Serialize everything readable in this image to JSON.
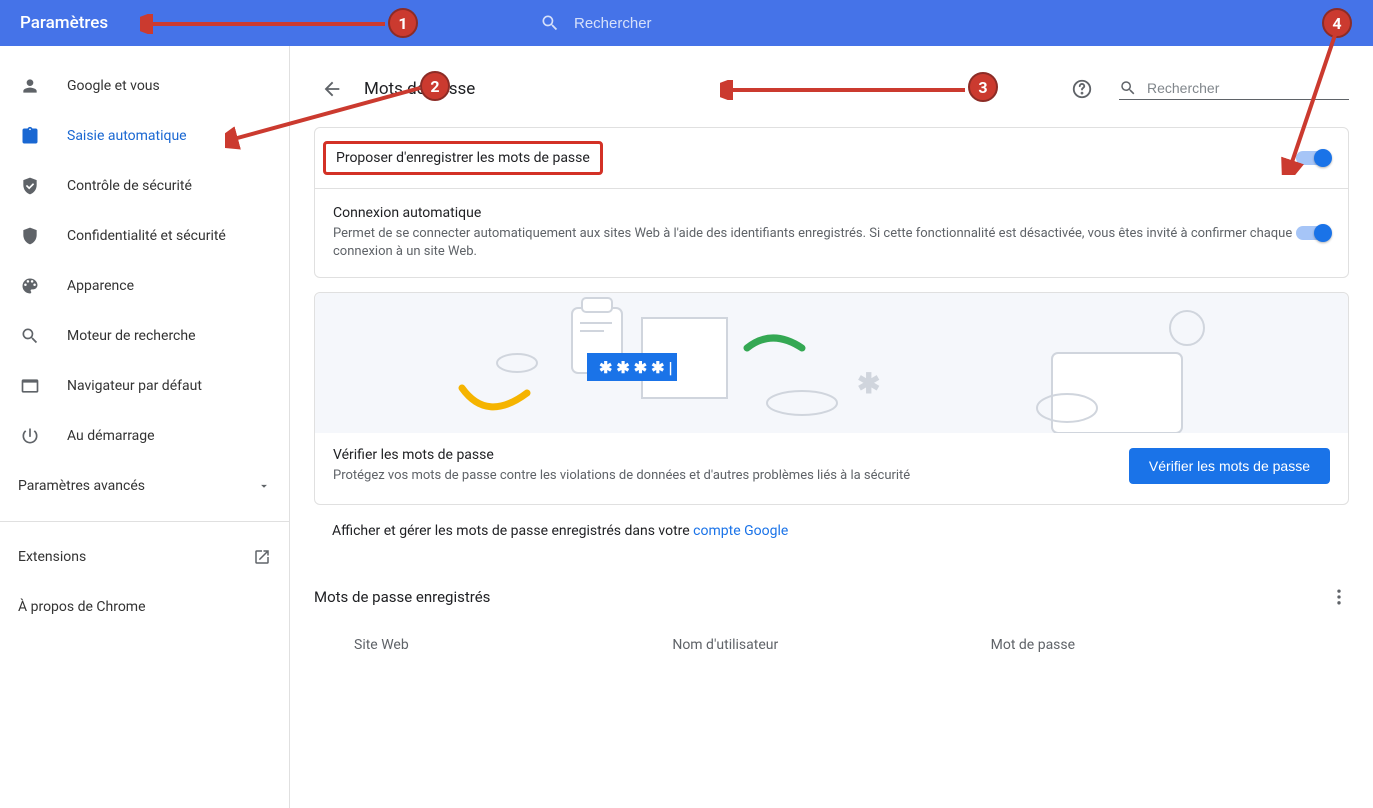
{
  "header": {
    "title": "Paramètres",
    "search_placeholder": "Rechercher"
  },
  "sidebar": {
    "items": [
      {
        "label": "Google et vous"
      },
      {
        "label": "Saisie automatique"
      },
      {
        "label": "Contrôle de sécurité"
      },
      {
        "label": "Confidentialité et sécurité"
      },
      {
        "label": "Apparence"
      },
      {
        "label": "Moteur de recherche"
      },
      {
        "label": "Navigateur par défaut"
      },
      {
        "label": "Au démarrage"
      }
    ],
    "advanced_label": "Paramètres avancés",
    "extensions_label": "Extensions",
    "about_label": "À propos de Chrome"
  },
  "page": {
    "title": "Mots de passe",
    "search_placeholder": "Rechercher"
  },
  "settings": {
    "offer_save": "Proposer d'enregistrer les mots de passe",
    "auto_signin_title": "Connexion automatique",
    "auto_signin_desc": "Permet de se connecter automatiquement aux sites Web à l'aide des identifiants enregistrés. Si cette fonctionnalité est désactivée, vous êtes invité à confirmer chaque connexion à un site Web."
  },
  "check": {
    "title": "Vérifier les mots de passe",
    "desc": "Protégez vos mots de passe contre les violations de données et d'autres problèmes liés à la sécurité",
    "button": "Vérifier les mots de passe"
  },
  "account_sentence_prefix": "Afficher et gérer les mots de passe enregistrés dans votre ",
  "account_link": "compte Google",
  "saved": {
    "title": "Mots de passe enregistrés",
    "col_site": "Site Web",
    "col_user": "Nom d'utilisateur",
    "col_pwd": "Mot de passe"
  },
  "illustration_dots": "✱ ✱ ✱ ✱ |",
  "annotations": {
    "1": "1",
    "2": "2",
    "3": "3",
    "4": "4"
  }
}
